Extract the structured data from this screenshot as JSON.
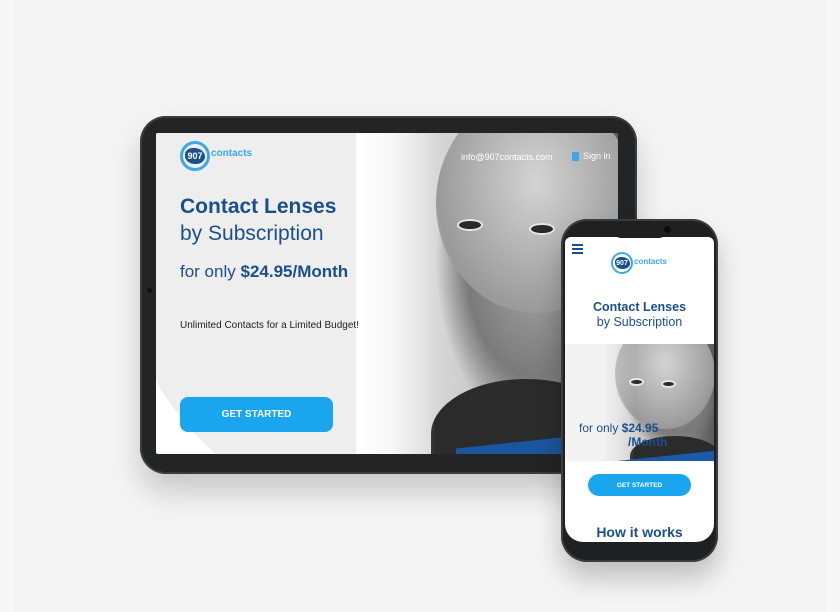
{
  "brand": {
    "logo_number": "907",
    "logo_word": "contacts",
    "primary_color": "#1b4f8c",
    "accent_color": "#1aa6ee"
  },
  "tablet": {
    "email": "info@907contacts.com",
    "signin": "Sign in",
    "title": "Contact Lenses",
    "subtitle": "by Subscription",
    "price_prefix": "for only ",
    "price": "$24.95/Month",
    "tagline": "Unlimited Contacts for a Limited Budget!",
    "cta": "GET STARTED"
  },
  "phone": {
    "title": "Contact Lenses",
    "subtitle": "by Subscription",
    "price_prefix": "for only ",
    "price_line1": "$24.95",
    "price_line2": "/Month",
    "cta": "GET STARTED",
    "section_heading": "How it works"
  },
  "icons": [
    "menu-icon",
    "sign-in-icon",
    "logo-icon"
  ]
}
